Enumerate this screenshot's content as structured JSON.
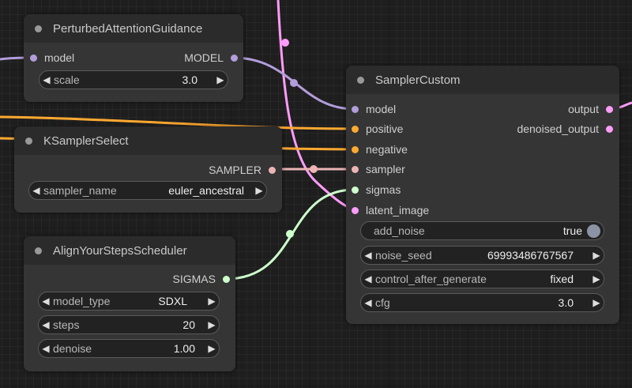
{
  "colors": {
    "model": "#b39ddb",
    "conditioning": "#ffa931",
    "sampler": "#ecb4b4",
    "sigmas": "#cdffcd",
    "latent": "#ff9cf9"
  },
  "nodes": {
    "pag": {
      "title": "PerturbedAttentionGuidance",
      "input_model": "model",
      "output_model": "MODEL",
      "widget_scale": {
        "label": "scale",
        "value": "3.0"
      }
    },
    "ksampler_select": {
      "title": "KSamplerSelect",
      "output_sampler": "SAMPLER",
      "widget_sampler_name": {
        "label": "sampler_name",
        "value": "euler_ancestral"
      }
    },
    "ays": {
      "title": "AlignYourStepsScheduler",
      "output_sigmas": "SIGMAS",
      "widget_model_type": {
        "label": "model_type",
        "value": "SDXL"
      },
      "widget_steps": {
        "label": "steps",
        "value": "20"
      },
      "widget_denoise": {
        "label": "denoise",
        "value": "1.00"
      }
    },
    "sampler_custom": {
      "title": "SamplerCustom",
      "inputs": {
        "model": "model",
        "positive": "positive",
        "negative": "negative",
        "sampler": "sampler",
        "sigmas": "sigmas",
        "latent_image": "latent_image"
      },
      "outputs": {
        "output": "output",
        "denoised_output": "denoised_output"
      },
      "widget_add_noise": {
        "label": "add_noise",
        "value": "true"
      },
      "widget_noise_seed": {
        "label": "noise_seed",
        "value": "69993486767567"
      },
      "widget_control_after_generate": {
        "label": "control_after_generate",
        "value": "fixed"
      },
      "widget_cfg": {
        "label": "cfg",
        "value": "3.0"
      }
    }
  }
}
